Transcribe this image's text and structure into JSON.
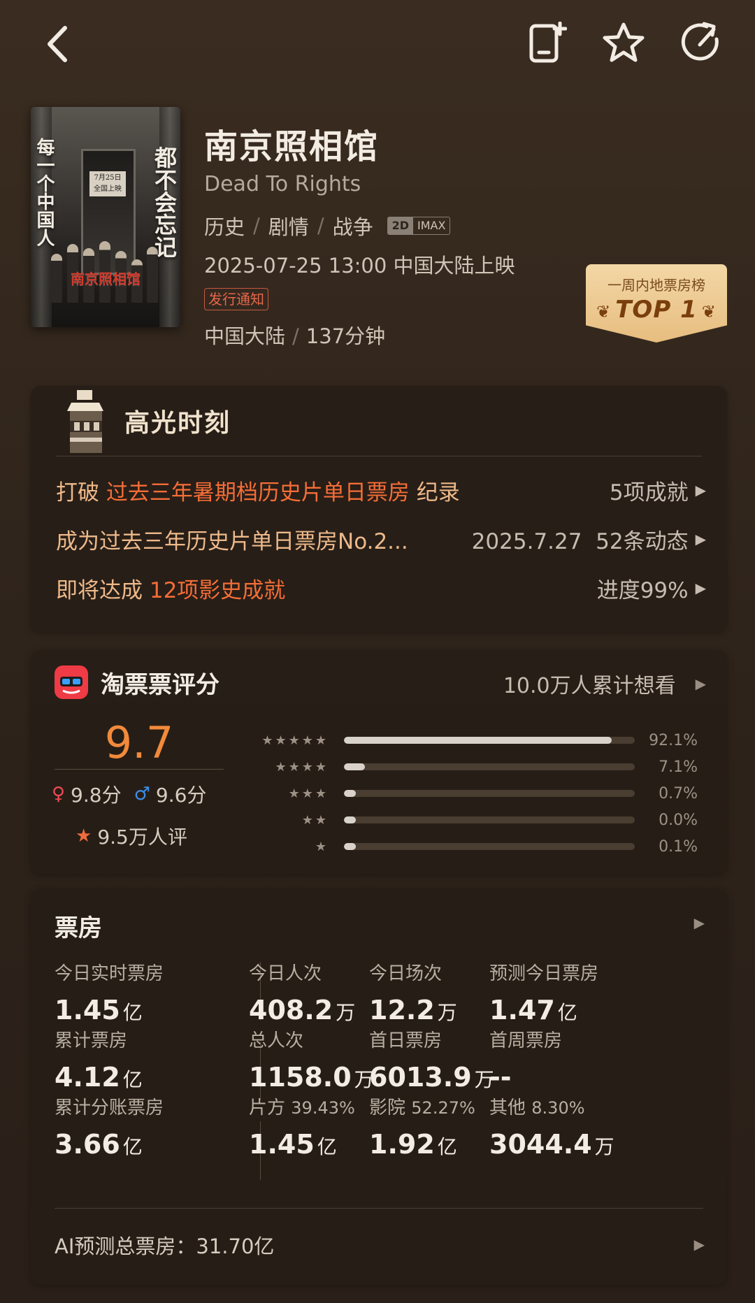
{
  "movie": {
    "title": "南京照相馆",
    "title_en": "Dead To Rights",
    "genres": [
      "历史",
      "剧情",
      "战争"
    ],
    "formats": [
      "2D",
      "IMAX"
    ],
    "release": "2025-07-25 13:00 中国大陆上映",
    "notice_tag": "发行通知",
    "region": "中国大陆",
    "duration": "137分钟",
    "poster": {
      "left_text": "每一个中国人",
      "right_text": "都不会忘记",
      "plaque": "7月25日 全国上映",
      "stamp": "南京照相馆"
    }
  },
  "rank_badge": {
    "label": "一周内地票房榜",
    "value": "TOP 1"
  },
  "highlight": {
    "title": "高光时刻",
    "rows": [
      {
        "pre": "打破 ",
        "hot": "过去三年暑期档历史片单日票房",
        "post": " 纪录",
        "right": "5项成就"
      },
      {
        "pre": "成为过去三年历史片单日票房No.2...",
        "hot": "",
        "post": "",
        "right": "2025.7.27  52条动态"
      },
      {
        "pre": "即将达成 ",
        "hot": "12项影史成就",
        "post": "",
        "right": "进度99%"
      }
    ]
  },
  "rating": {
    "title": "淘票票评分",
    "want": "10.0万人累计想看",
    "score": "9.7",
    "female_score": "9.8分",
    "male_score": "9.6分",
    "raters": "9.5万人评",
    "distribution": [
      {
        "stars": "★★★★★",
        "pct_label": "92.1%",
        "pct": 0.921
      },
      {
        "stars": "★★★★",
        "pct_label": "7.1%",
        "pct": 0.071
      },
      {
        "stars": "★★★",
        "pct_label": "0.7%",
        "pct": 0.007
      },
      {
        "stars": "★★",
        "pct_label": "0.0%",
        "pct": 0.0
      },
      {
        "stars": "★",
        "pct_label": "0.1%",
        "pct": 0.001
      }
    ]
  },
  "box_office": {
    "title": "票房",
    "cells": [
      {
        "label": "今日实时票房",
        "value": "1.45",
        "unit": "亿"
      },
      {
        "label": "今日人次",
        "value": "408.2",
        "unit": "万"
      },
      {
        "label": "今日场次",
        "value": "12.2",
        "unit": "万"
      },
      {
        "label": "预测今日票房",
        "value": "1.47",
        "unit": "亿"
      },
      {
        "label": "累计票房",
        "value": "4.12",
        "unit": "亿"
      },
      {
        "label": "总人次",
        "value": "1158.0",
        "unit": "万"
      },
      {
        "label": "首日票房",
        "value": "6013.9",
        "unit": "万"
      },
      {
        "label": "首周票房",
        "value": "--",
        "unit": ""
      },
      {
        "label": "累计分账票房",
        "value": "3.66",
        "unit": "亿"
      },
      {
        "label": "片方",
        "pct": "39.43%",
        "value": "1.45",
        "unit": "亿"
      },
      {
        "label": "影院",
        "pct": "52.27%",
        "value": "1.92",
        "unit": "亿"
      },
      {
        "label": "其他",
        "pct": "8.30%",
        "value": "3044.4",
        "unit": "万"
      }
    ],
    "ai_forecast": "AI预测总票房：31.70亿"
  }
}
